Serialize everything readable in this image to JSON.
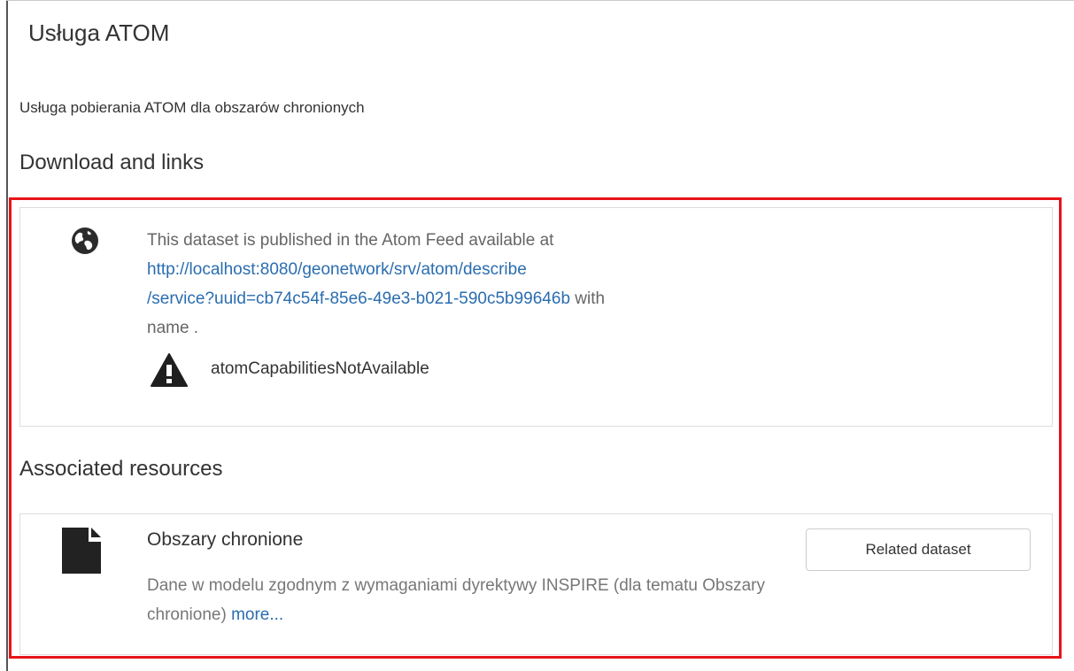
{
  "service": {
    "title": "Usługa ATOM",
    "abstract": "Usługa pobierania ATOM dla obszarów chronionych"
  },
  "download": {
    "section_title": "Download and links",
    "feed_prefix": "This dataset is published in the Atom Feed available at",
    "feed_link_line1": "http://localhost:8080/geonetwork/srv/atom/describe",
    "feed_link_line2": "/service?uuid=cb74c54f-85e6-49e3-b021-590c5b99646b",
    "feed_suffix": "with",
    "feed_name": "name .",
    "warning_text": "atomCapabilitiesNotAvailable",
    "globe_icon": "globe-icon",
    "warning_icon": "warning-icon"
  },
  "associated": {
    "section_title": "Associated resources",
    "resources": [
      {
        "title": "Obszary chronione",
        "description": "Dane w modelu zgodnym z wymaganiami dyrektywy INSPIRE (dla tematu Obszary chronione)",
        "more_label": "more...",
        "button_label": "Related dataset",
        "icon": "file-icon"
      }
    ]
  },
  "colors": {
    "highlight": "#e8141a",
    "link": "#2a6db0",
    "panel_border": "#dddddd"
  }
}
